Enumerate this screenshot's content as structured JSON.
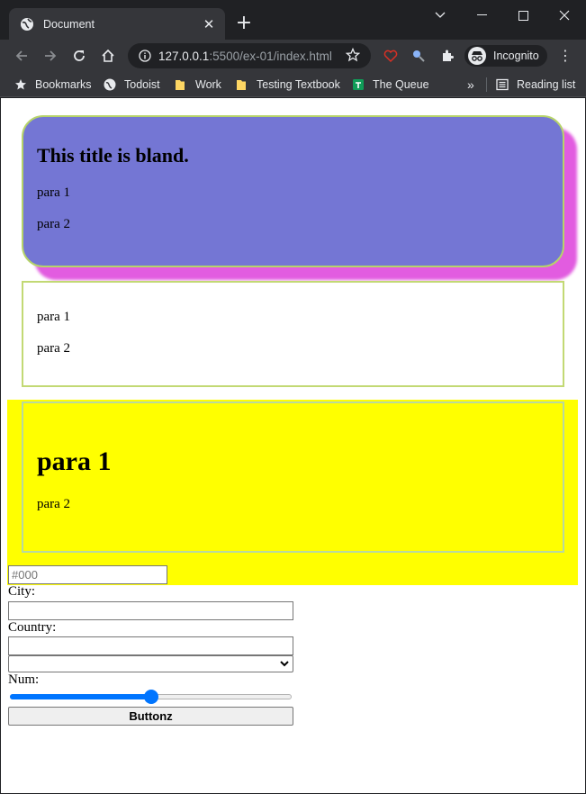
{
  "browser": {
    "tab_title": "Document",
    "address_host": "127.0.0.1",
    "address_path": ":5500/ex-01/index.html",
    "profile_label": "Incognito",
    "bookmarks": [
      {
        "label": "Bookmarks",
        "icon": "star-icon"
      },
      {
        "label": "Todoist",
        "icon": "globe-icon"
      },
      {
        "label": "Work",
        "icon": "folder-icon"
      },
      {
        "label": "Testing Textbook",
        "icon": "folder-icon"
      },
      {
        "label": "The Queue",
        "icon": "sheets-icon"
      }
    ],
    "overflow_label": "»",
    "reading_list_label": "Reading list",
    "colors": {
      "chrome_dark": "#202124",
      "chrome_toolbar": "#35363a"
    }
  },
  "page": {
    "card1": {
      "title": "This title is bland.",
      "para1": "para 1",
      "para2": "para 2",
      "bg": "#7476d4",
      "shadow": "#e25ce0",
      "border": "#b6d36a"
    },
    "card2": {
      "para1": "para 1",
      "para2": "para 2"
    },
    "card3": {
      "heading": "para 1",
      "para2": "para 2",
      "band_bg": "#ffff00"
    },
    "form": {
      "hex_placeholder": "#000",
      "city_label": "City:",
      "country_label": "Country:",
      "num_label": "Num:",
      "num_value": 50,
      "button_label": "Buttonz",
      "accent": "#0075ff"
    }
  }
}
